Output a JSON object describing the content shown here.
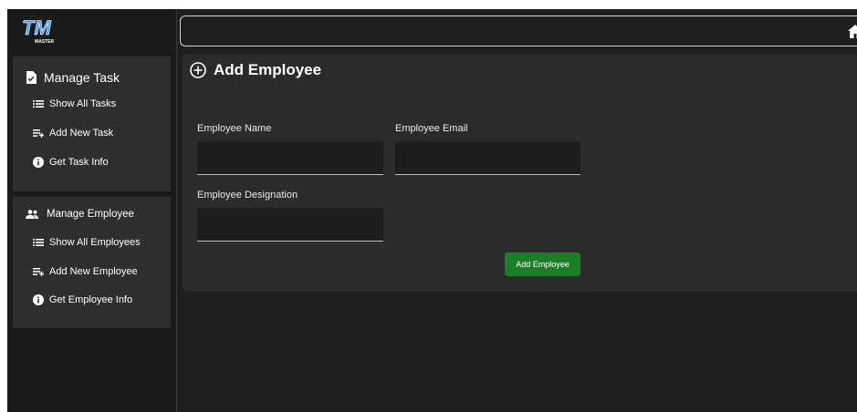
{
  "app": {
    "logo_text": "TM",
    "logo_subtext": "MASTER"
  },
  "sidebar": {
    "task_section": {
      "title": "Manage Task",
      "items": [
        {
          "label": "Show All Tasks",
          "icon": "list-icon"
        },
        {
          "label": "Add New Task",
          "icon": "playlist-add-icon"
        },
        {
          "label": "Get Task Info",
          "icon": "info-icon"
        }
      ]
    },
    "employee_section": {
      "title": "Manage Employee",
      "items": [
        {
          "label": "Show All Employees",
          "icon": "list-icon"
        },
        {
          "label": "Add New Employee",
          "icon": "playlist-add-icon"
        },
        {
          "label": "Get Employee Info",
          "icon": "info-icon"
        }
      ]
    }
  },
  "header": {
    "icon": "home-icon"
  },
  "form": {
    "title": "Add Employee",
    "fields": {
      "name": {
        "label": "Employee Name",
        "value": ""
      },
      "email": {
        "label": "Employee Email",
        "value": ""
      },
      "designation": {
        "label": "Employee Designation",
        "value": ""
      }
    },
    "submit_label": "Add Employee"
  },
  "colors": {
    "accent_green": "#1a7f24",
    "logo_blue": "#4aa3ff",
    "panel": "#2b2b2b",
    "background": "#1e1e1e"
  }
}
